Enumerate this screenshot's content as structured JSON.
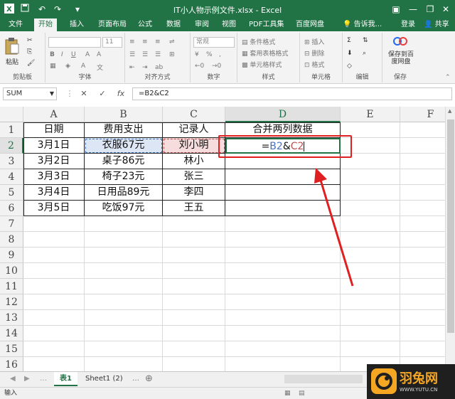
{
  "window": {
    "title": "IT小人物示例文件.xlsx - Excel"
  },
  "tabs": [
    "文件",
    "开始",
    "插入",
    "页面布局",
    "公式",
    "数据",
    "审阅",
    "视图",
    "PDF工具集",
    "百度网盘"
  ],
  "active_tab": "开始",
  "tell_me": "告诉我...",
  "login": "登录",
  "share": "共享",
  "ribbon": {
    "paste": "粘贴",
    "font_size": "11",
    "number_format": "常规",
    "conditional_format": "条件格式",
    "table_format": "套用表格格式",
    "cell_style": "单元格样式",
    "insert": "插入",
    "delete": "删除",
    "format": "格式",
    "save_baidu": "保存到百度网盘",
    "groups": [
      "剪贴板",
      "字体",
      "对齐方式",
      "数字",
      "样式",
      "单元格",
      "编辑",
      "保存"
    ]
  },
  "formula_bar": {
    "name_box": "SUM",
    "cancel": "✕",
    "enter": "✓",
    "fx": "fx",
    "formula": "=B2&C2"
  },
  "columns": [
    "A",
    "B",
    "C",
    "D",
    "E",
    "F"
  ],
  "rows": [
    "1",
    "2",
    "3",
    "4",
    "5",
    "6",
    "7",
    "8",
    "9",
    "10",
    "11",
    "12",
    "13",
    "14",
    "15",
    "16"
  ],
  "table": {
    "headers": [
      "日期",
      "费用支出",
      "记录人",
      "合并两列数据"
    ],
    "data": [
      [
        "3月1日",
        "衣服67元",
        "刘小明",
        "=B2&C2"
      ],
      [
        "3月2日",
        "桌子86元",
        "林小",
        ""
      ],
      [
        "3月3日",
        "椅子23元",
        "张三",
        ""
      ],
      [
        "3月4日",
        "日用品89元",
        "李四",
        ""
      ],
      [
        "3月5日",
        "吃饭97元",
        "王五",
        ""
      ]
    ]
  },
  "active_formula_parts": {
    "eq": "=",
    "ref1": "B2",
    "amp": "&",
    "ref2": "C2"
  },
  "sheets": [
    "表1",
    "Sheet1 (2)"
  ],
  "active_sheet": "表1",
  "status": "输入",
  "watermark": {
    "brand": "羽兔网",
    "url": "WWW.YUTU.CN"
  },
  "colors": {
    "excel_green": "#217346",
    "ref_blue": "#4472c4",
    "ref_red": "#c0504d",
    "annotation_red": "#e02020"
  }
}
